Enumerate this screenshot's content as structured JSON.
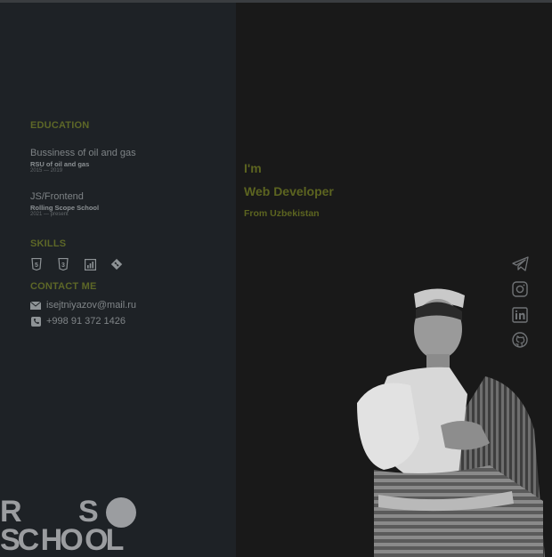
{
  "education": {
    "heading": "EDUCATION",
    "items": [
      {
        "title": "Bussiness of oil and gas",
        "school": "RSU of oil and gas",
        "dates": "2015 — 2019"
      },
      {
        "title": "JS/Frontend",
        "school": "Rolling Scope School",
        "dates": "2021 — present"
      }
    ]
  },
  "skills": {
    "heading": "SKILLS",
    "icons": [
      "html5-icon",
      "css3-icon",
      "chart-icon",
      "git-icon"
    ]
  },
  "contact": {
    "heading": "CONTACT ME",
    "email": "isejtniyazov@mail.ru",
    "phone": "+998 91 372 1426"
  },
  "logo": {
    "row1_a": "R",
    "row1_b": "S",
    "row2": "SC HO OL"
  },
  "intro": {
    "greeting": "I'm",
    "role": "Web Developer",
    "origin": "From Uzbekistan"
  },
  "social": [
    "telegram-icon",
    "instagram-icon",
    "linkedin-icon",
    "github-icon"
  ],
  "colors": {
    "accent": "#5d6727",
    "left_bg": "#1e2226",
    "right_bg": "#191919"
  }
}
